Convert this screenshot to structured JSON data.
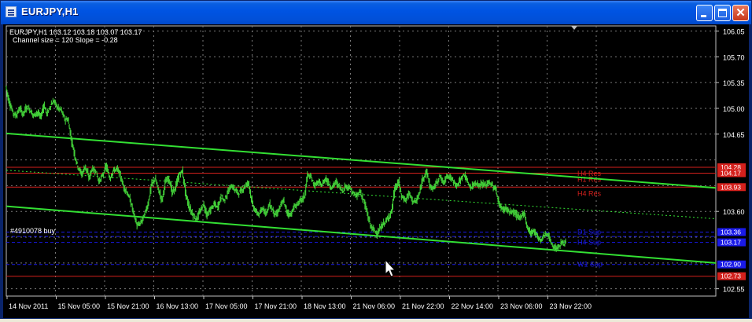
{
  "window": {
    "title": "EURJPY,H1",
    "minimize_icon": "minimize-icon",
    "maximize_icon": "maximize-icon",
    "close_icon": "close-icon"
  },
  "chart_info": {
    "line1": "EURJPY,H1  103.12 103.18 103.07 103.17",
    "line2": "Channel size = 120 Slope = -0.28"
  },
  "trade_label": "#4910078 buy",
  "colors": {
    "background": "#000000",
    "candle": "#44d43a",
    "channel": "#33e033",
    "resistance": "#d4201c",
    "support": "#1a1ae8",
    "grid": "#7a7a7a",
    "axis_text": "#ffffff"
  },
  "chart_data": {
    "type": "candlestick",
    "symbol": "EURJPY",
    "timeframe": "H1",
    "ohlc_last": {
      "open": 103.12,
      "high": 103.18,
      "low": 103.07,
      "close": 103.17
    },
    "ylim": [
      102.45,
      106.12
    ],
    "x_ticks": [
      "14 Nov 2011",
      "15 Nov 05:00",
      "15 Nov 21:00",
      "16 Nov 13:00",
      "17 Nov 05:00",
      "17 Nov 21:00",
      "18 Nov 13:00",
      "21 Nov 06:00",
      "21 Nov 22:00",
      "22 Nov 14:00",
      "23 Nov 06:00",
      "23 Nov 22:00"
    ],
    "y_ticks": [
      106.05,
      105.7,
      105.35,
      105.0,
      104.65,
      103.6,
      102.55
    ],
    "price_path": [
      [
        0,
        105.3
      ],
      [
        4,
        105.1
      ],
      [
        9,
        104.95
      ],
      [
        13,
        104.9
      ],
      [
        18,
        105.0
      ],
      [
        22,
        104.92
      ],
      [
        27,
        105.02
      ],
      [
        31,
        104.98
      ],
      [
        36,
        104.9
      ],
      [
        40,
        104.95
      ],
      [
        45,
        104.88
      ],
      [
        49,
        105.05
      ],
      [
        53,
        104.92
      ],
      [
        58,
        105.05
      ],
      [
        62,
        105.1
      ],
      [
        67,
        105.0
      ],
      [
        71,
        104.98
      ],
      [
        76,
        104.85
      ],
      [
        80,
        104.85
      ],
      [
        84,
        104.6
      ],
      [
        89,
        104.35
      ],
      [
        93,
        104.2
      ],
      [
        98,
        104.1
      ],
      [
        102,
        104.22
      ],
      [
        107,
        104.05
      ],
      [
        111,
        104.18
      ],
      [
        116,
        104.15
      ],
      [
        120,
        104.0
      ],
      [
        125,
        104.1
      ],
      [
        129,
        104.22
      ],
      [
        134,
        104.05
      ],
      [
        138,
        104.15
      ],
      [
        143,
        104.18
      ],
      [
        147,
        104.1
      ],
      [
        151,
        103.95
      ],
      [
        156,
        103.85
      ],
      [
        160,
        103.75
      ],
      [
        165,
        103.55
      ],
      [
        169,
        103.4
      ],
      [
        174,
        103.45
      ],
      [
        178,
        103.55
      ],
      [
        183,
        103.7
      ],
      [
        187,
        103.95
      ],
      [
        192,
        104.05
      ],
      [
        196,
        103.9
      ],
      [
        201,
        103.75
      ],
      [
        205,
        104.0
      ],
      [
        210,
        104.05
      ],
      [
        214,
        103.85
      ],
      [
        218,
        103.92
      ],
      [
        223,
        104.1
      ],
      [
        227,
        104.15
      ],
      [
        232,
        103.8
      ],
      [
        236,
        103.65
      ],
      [
        241,
        103.55
      ],
      [
        245,
        103.5
      ],
      [
        250,
        103.6
      ],
      [
        254,
        103.7
      ],
      [
        259,
        103.55
      ],
      [
        263,
        103.62
      ],
      [
        268,
        103.7
      ],
      [
        272,
        103.65
      ],
      [
        277,
        103.8
      ],
      [
        281,
        103.75
      ],
      [
        285,
        103.85
      ],
      [
        290,
        103.95
      ],
      [
        294,
        103.9
      ],
      [
        299,
        103.85
      ],
      [
        303,
        103.88
      ],
      [
        308,
        103.95
      ],
      [
        312,
        104.0
      ],
      [
        317,
        103.7
      ],
      [
        321,
        103.6
      ],
      [
        326,
        103.55
      ],
      [
        330,
        103.65
      ],
      [
        335,
        103.58
      ],
      [
        339,
        103.7
      ],
      [
        344,
        103.6
      ],
      [
        348,
        103.55
      ],
      [
        352,
        103.65
      ],
      [
        357,
        103.75
      ],
      [
        361,
        103.6
      ],
      [
        366,
        103.55
      ],
      [
        370,
        103.65
      ],
      [
        375,
        103.7
      ],
      [
        379,
        103.75
      ],
      [
        384,
        103.8
      ],
      [
        388,
        104.1
      ],
      [
        393,
        104.05
      ],
      [
        397,
        103.95
      ],
      [
        402,
        104.0
      ],
      [
        406,
        103.95
      ],
      [
        411,
        104.05
      ],
      [
        415,
        103.98
      ],
      [
        419,
        103.92
      ],
      [
        424,
        104.0
      ],
      [
        428,
        103.95
      ],
      [
        433,
        103.88
      ],
      [
        437,
        103.95
      ],
      [
        442,
        103.92
      ],
      [
        446,
        103.85
      ],
      [
        451,
        103.8
      ],
      [
        455,
        103.88
      ],
      [
        460,
        103.75
      ],
      [
        464,
        103.6
      ],
      [
        469,
        103.4
      ],
      [
        473,
        103.35
      ],
      [
        478,
        103.3
      ],
      [
        482,
        103.38
      ],
      [
        487,
        103.45
      ],
      [
        491,
        103.5
      ],
      [
        496,
        103.6
      ],
      [
        500,
        103.9
      ],
      [
        505,
        104.0
      ],
      [
        509,
        103.8
      ],
      [
        514,
        103.75
      ],
      [
        518,
        103.85
      ],
      [
        523,
        103.75
      ],
      [
        527,
        103.72
      ],
      [
        532,
        103.85
      ],
      [
        536,
        104.05
      ],
      [
        541,
        104.15
      ],
      [
        545,
        103.95
      ],
      [
        549,
        103.9
      ],
      [
        554,
        104.0
      ],
      [
        558,
        104.08
      ],
      [
        563,
        103.98
      ],
      [
        567,
        104.1
      ],
      [
        572,
        104.05
      ],
      [
        576,
        104.0
      ],
      [
        581,
        103.95
      ],
      [
        585,
        104.05
      ],
      [
        590,
        104.1
      ],
      [
        594,
        103.98
      ],
      [
        599,
        103.92
      ],
      [
        603,
        104.0
      ],
      [
        608,
        103.95
      ],
      [
        612,
        103.98
      ],
      [
        616,
        103.95
      ],
      [
        621,
        104.0
      ],
      [
        625,
        103.95
      ],
      [
        630,
        103.9
      ],
      [
        634,
        103.7
      ],
      [
        639,
        103.62
      ],
      [
        643,
        103.65
      ],
      [
        648,
        103.58
      ],
      [
        652,
        103.6
      ],
      [
        657,
        103.55
      ],
      [
        661,
        103.5
      ],
      [
        666,
        103.6
      ],
      [
        670,
        103.4
      ],
      [
        675,
        103.3
      ],
      [
        679,
        103.35
      ],
      [
        684,
        103.25
      ],
      [
        688,
        103.2
      ],
      [
        693,
        103.3
      ],
      [
        697,
        103.28
      ],
      [
        702,
        103.15
      ],
      [
        706,
        103.1
      ],
      [
        711,
        103.12
      ],
      [
        715,
        103.18
      ],
      [
        720,
        103.17
      ]
    ],
    "channel": {
      "upper": [
        [
          104.66,
          103.92
        ],
        [
          0,
          903
        ]
      ],
      "lower": [
        [
          103.67,
          102.9
        ],
        [
          0,
          903
        ]
      ],
      "mid_dashed": [
        [
          104.16,
          103.5
        ],
        [
          0,
          903
        ]
      ]
    },
    "horizontal_lines": [
      {
        "name": "H4 Res",
        "price": 104.2,
        "color": "#d4201c",
        "label": "H4 Res"
      },
      {
        "name": "H1 Res",
        "price": 104.12,
        "color": "#d4201c",
        "label": "H1 Res"
      },
      {
        "name": "H4 Res",
        "price": 103.93,
        "color": "#d4201c",
        "label": "H4 Res"
      },
      {
        "name": "D1 Sup",
        "price": 103.32,
        "color": "#1a1ae8",
        "label": "D1 Sup"
      },
      {
        "name": "H4 Sup",
        "price": 103.18,
        "color": "#1a1ae8",
        "label": "H4 Sup"
      },
      {
        "name": "W1 Sup",
        "price": 102.88,
        "color": "#1a1ae8",
        "label": "W1 Sup"
      },
      {
        "name": "Trade",
        "price": 103.26,
        "color": "#1a1ae8",
        "label": ""
      },
      {
        "name": "W1 Res",
        "price": 102.72,
        "color": "#d4201c",
        "label": ""
      }
    ],
    "price_tags": [
      {
        "text": "104.28",
        "price": 104.2,
        "color": "#d4201c"
      },
      {
        "text": "104.17",
        "price": 104.12,
        "color": "#d4201c"
      },
      {
        "text": "103.93",
        "price": 103.93,
        "color": "#d4201c"
      },
      {
        "text": "103.36",
        "price": 103.32,
        "color": "#1a1ae8"
      },
      {
        "text": "103.17",
        "price": 103.18,
        "color": "#1a1ae8"
      },
      {
        "text": "102.90",
        "price": 102.88,
        "color": "#1a1ae8"
      },
      {
        "text": "102.73",
        "price": 102.72,
        "color": "#d4201c"
      }
    ]
  }
}
